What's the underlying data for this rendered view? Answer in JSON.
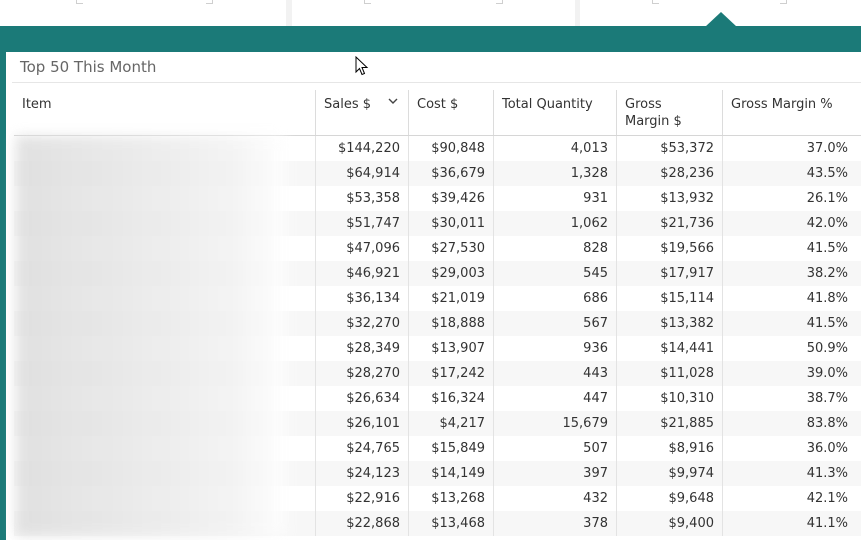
{
  "panel": {
    "title": "Top 50 This Month"
  },
  "columns": [
    {
      "label": "Item"
    },
    {
      "label": "Sales $"
    },
    {
      "label": "Cost $"
    },
    {
      "label": "Total Quantity"
    },
    {
      "label": "Gross\nMargin $"
    },
    {
      "label": "Gross Margin %"
    }
  ],
  "sort": {
    "column": "Sales $",
    "direction": "descending",
    "icon": "chevron-down-icon"
  },
  "rows": [
    {
      "sales": "$144,220",
      "cost": "$90,848",
      "qty": "4,013",
      "gm": "$53,372",
      "gmp": "37.0%"
    },
    {
      "sales": "$64,914",
      "cost": "$36,679",
      "qty": "1,328",
      "gm": "$28,236",
      "gmp": "43.5%"
    },
    {
      "sales": "$53,358",
      "cost": "$39,426",
      "qty": "931",
      "gm": "$13,932",
      "gmp": "26.1%"
    },
    {
      "sales": "$51,747",
      "cost": "$30,011",
      "qty": "1,062",
      "gm": "$21,736",
      "gmp": "42.0%"
    },
    {
      "sales": "$47,096",
      "cost": "$27,530",
      "qty": "828",
      "gm": "$19,566",
      "gmp": "41.5%"
    },
    {
      "sales": "$46,921",
      "cost": "$29,003",
      "qty": "545",
      "gm": "$17,917",
      "gmp": "38.2%"
    },
    {
      "sales": "$36,134",
      "cost": "$21,019",
      "qty": "686",
      "gm": "$15,114",
      "gmp": "41.8%"
    },
    {
      "sales": "$32,270",
      "cost": "$18,888",
      "qty": "567",
      "gm": "$13,382",
      "gmp": "41.5%"
    },
    {
      "sales": "$28,349",
      "cost": "$13,907",
      "qty": "936",
      "gm": "$14,441",
      "gmp": "50.9%"
    },
    {
      "sales": "$28,270",
      "cost": "$17,242",
      "qty": "443",
      "gm": "$11,028",
      "gmp": "39.0%"
    },
    {
      "sales": "$26,634",
      "cost": "$16,324",
      "qty": "447",
      "gm": "$10,310",
      "gmp": "38.7%"
    },
    {
      "sales": "$26,101",
      "cost": "$4,217",
      "qty": "15,679",
      "gm": "$21,885",
      "gmp": "83.8%"
    },
    {
      "sales": "$24,765",
      "cost": "$15,849",
      "qty": "507",
      "gm": "$8,916",
      "gmp": "36.0%"
    },
    {
      "sales": "$24,123",
      "cost": "$14,149",
      "qty": "397",
      "gm": "$9,974",
      "gmp": "41.3%"
    },
    {
      "sales": "$22,916",
      "cost": "$13,268",
      "qty": "432",
      "gm": "$9,648",
      "gmp": "42.1%"
    },
    {
      "sales": "$22,868",
      "cost": "$13,468",
      "qty": "378",
      "gm": "$9,400",
      "gmp": "41.1%"
    }
  ],
  "colors": {
    "frame": "#1b7a78",
    "alt_row": "#f7f7f7"
  }
}
